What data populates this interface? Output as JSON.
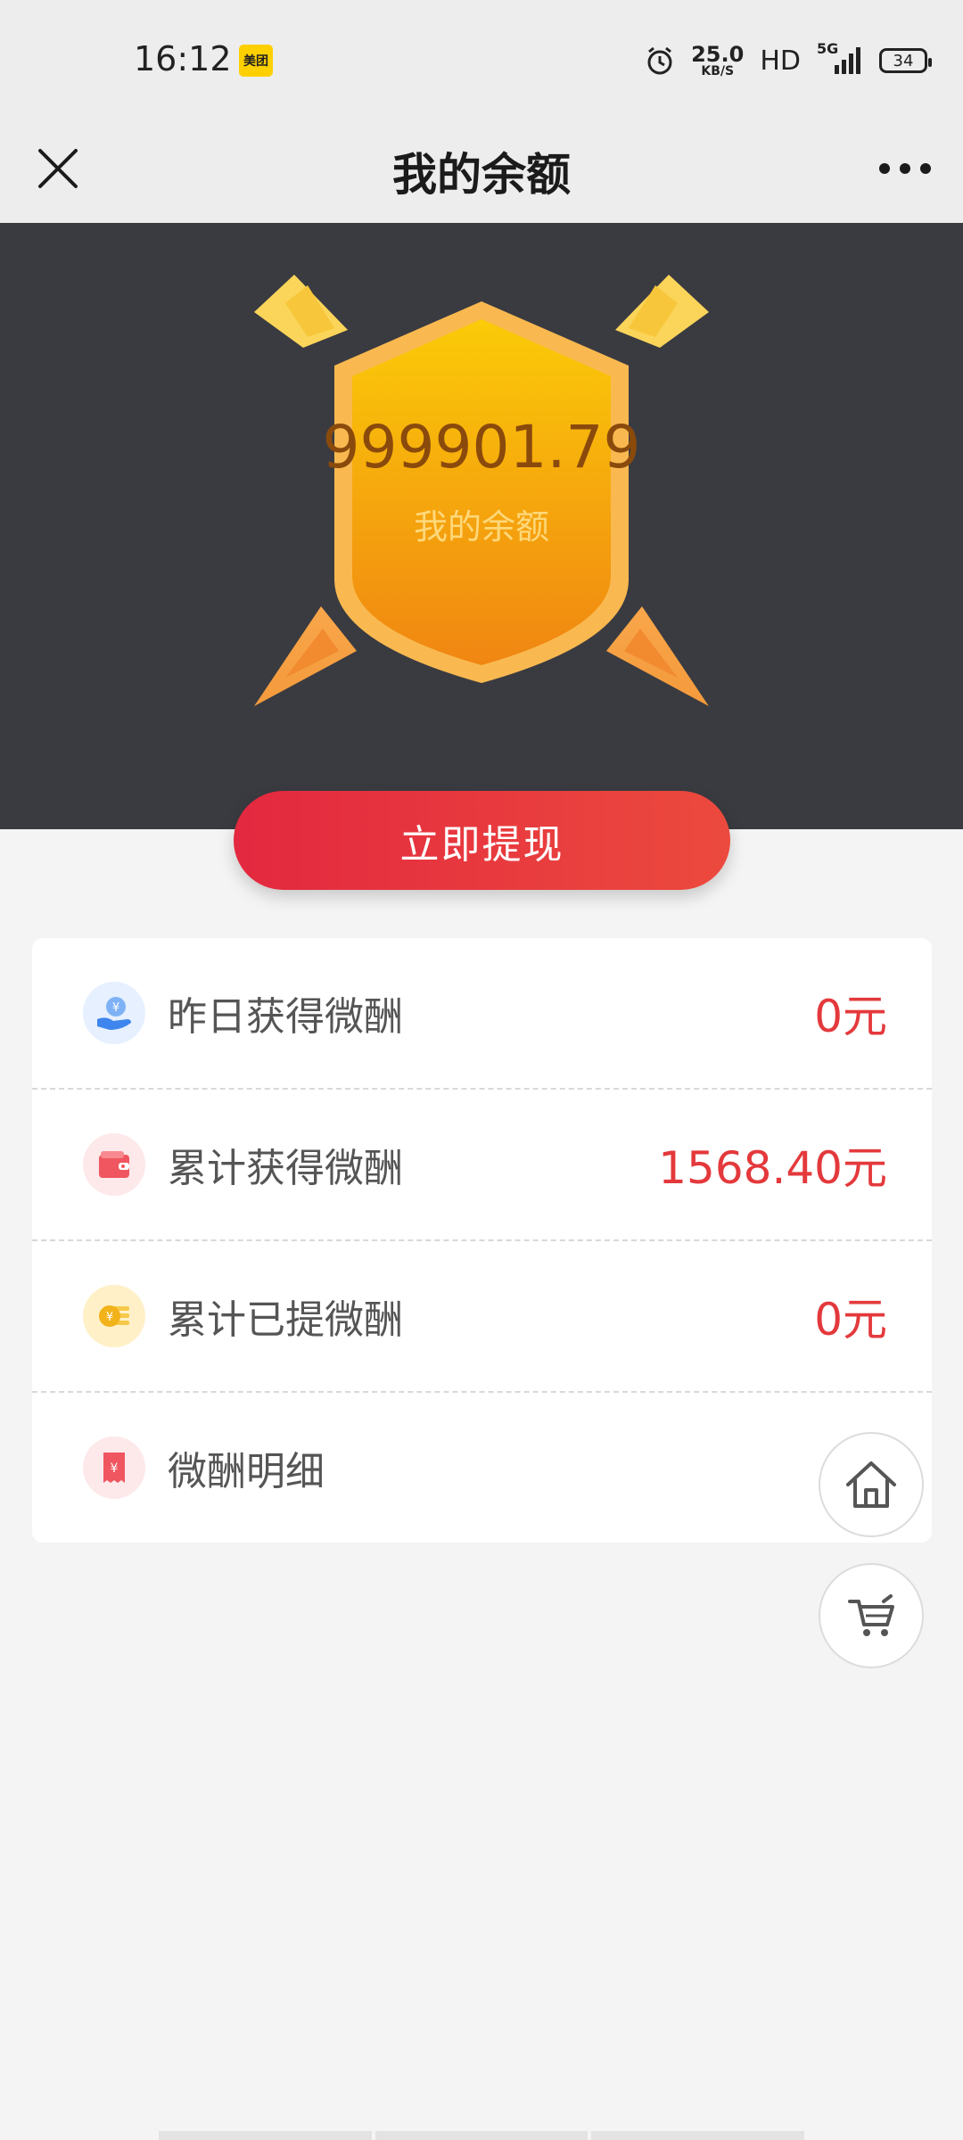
{
  "status_bar": {
    "time": "16:12",
    "app_badge": "美团",
    "net_speed_value": "25.0",
    "net_speed_unit": "KB/S",
    "hd": "HD",
    "signal": "5G",
    "battery": "34"
  },
  "header": {
    "title": "我的余额",
    "close_icon": "close-icon",
    "more_icon": "more-icon"
  },
  "hero": {
    "balance_amount": "999901.79",
    "balance_label": "我的余额"
  },
  "withdraw_button": {
    "label": "立即提现"
  },
  "list": {
    "items": [
      {
        "label": "昨日获得微酬",
        "value": "0元",
        "icon": "hand-coin-icon"
      },
      {
        "label": "累计获得微酬",
        "value": "1568.40元",
        "icon": "wallet-icon"
      },
      {
        "label": "累计已提微酬",
        "value": "0元",
        "icon": "coin-icon"
      },
      {
        "label": "微酬明细",
        "value": "",
        "icon": "receipt-icon"
      }
    ]
  },
  "floating": {
    "home_icon": "home-icon",
    "cart_icon": "cart-icon"
  },
  "colors": {
    "accent_red": "#e4393c",
    "hero_bg": "#3a3b40",
    "shield_gold": "#f9c400"
  }
}
